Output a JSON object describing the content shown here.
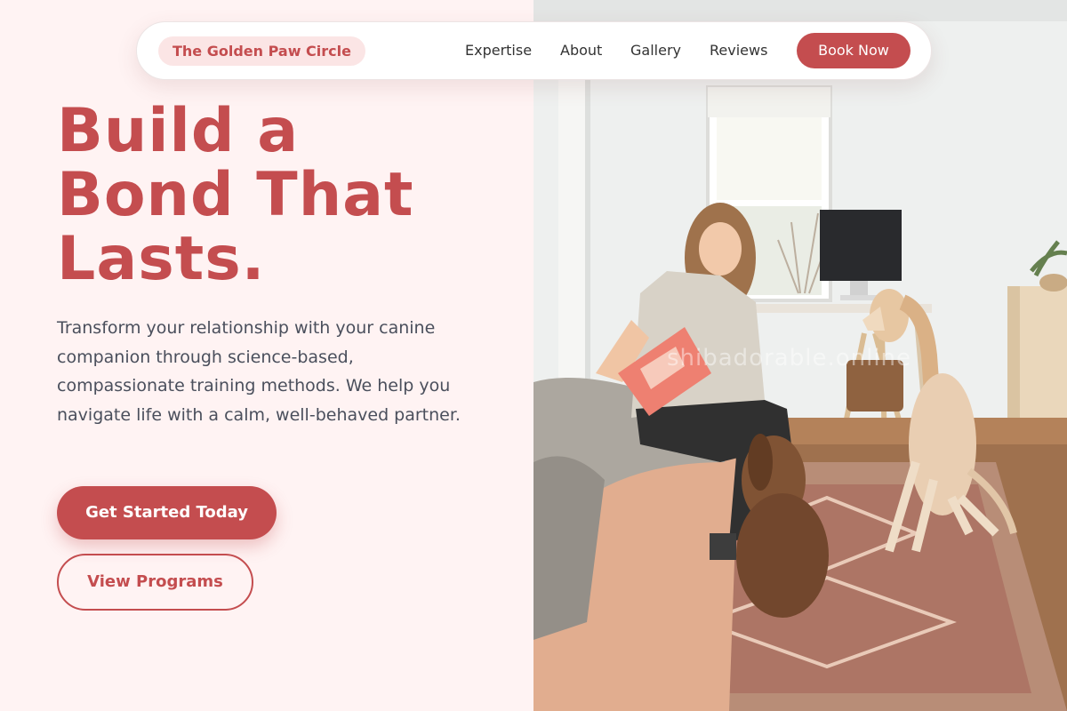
{
  "nav": {
    "brand": "The Golden Paw Circle",
    "links": [
      "Expertise",
      "About",
      "Gallery",
      "Reviews"
    ],
    "cta": "Book Now"
  },
  "hero": {
    "headline_lines": [
      "Build a",
      "Bond That",
      "Lasts."
    ],
    "description": "Transform your relationship with your canine companion through science-based, compassionate training methods. We help you navigate life with a calm, well-behaved partner.",
    "primary_button": "Get Started Today",
    "secondary_button": "View Programs"
  },
  "photo": {
    "watermark": "shibadorable.online"
  },
  "colors": {
    "accent": "#c44d4f",
    "background": "#fff3f3",
    "text": "#4a4f5c"
  }
}
